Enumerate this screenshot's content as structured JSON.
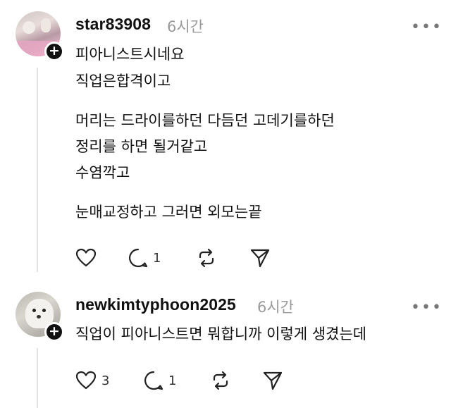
{
  "comments": [
    {
      "username": "star83908",
      "time": "6시간",
      "lines": [
        "피아니스트시네요",
        "직업은합격이고",
        "머리는 드라이를하던 다듬던 고데기를하던",
        "정리를 하면 될거같고",
        "수염깍고",
        "눈매교정하고 그러면 외모는끝"
      ],
      "likes": "",
      "replies": "1"
    },
    {
      "username": "newkimtyphoon2025",
      "time": "6시간",
      "lines": [
        "직업이 피아니스트면 뭐합니까 이렇게 생겼는데"
      ],
      "likes": "3",
      "replies": "1"
    }
  ],
  "icons": {
    "follow": "plus-icon",
    "more": "more-icon",
    "like": "heart-icon",
    "reply": "comment-icon",
    "repost": "repost-icon",
    "share": "send-icon"
  },
  "more_glyph": "•••",
  "follow_glyph": "+"
}
